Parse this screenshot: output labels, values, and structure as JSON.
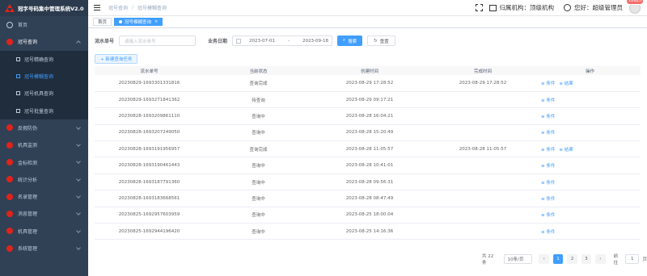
{
  "app_title": "冠字号码集中管理系统V2.0",
  "sidebar": {
    "items": [
      {
        "label": "首页",
        "icon": "home-icon"
      },
      {
        "label": "冠号查询",
        "icon": "search-icon"
      },
      {
        "label": "反假防伪",
        "icon": "shield-icon"
      },
      {
        "label": "机具监测",
        "icon": "monitor-icon"
      },
      {
        "label": "金标检测",
        "icon": "medal-icon"
      },
      {
        "label": "统计分析",
        "icon": "chart-icon"
      },
      {
        "label": "名录管理",
        "icon": "book-icon"
      },
      {
        "label": "消息管理",
        "icon": "message-icon"
      },
      {
        "label": "机具管理",
        "icon": "machine-icon"
      },
      {
        "label": "系统管理",
        "icon": "settings-icon"
      }
    ],
    "submenu": [
      {
        "label": "冠号精确查询"
      },
      {
        "label": "冠号模糊查询"
      },
      {
        "label": "冠号机具查询"
      },
      {
        "label": "冠号批量查询"
      }
    ]
  },
  "header": {
    "breadcrumb": [
      "冠号查询",
      "冠号模糊查询"
    ],
    "org_label": "归属机构：顶级机构",
    "user_label": "您好：超级管理员",
    "badge": "18925"
  },
  "tags": [
    {
      "label": "首页"
    },
    {
      "label": "冠号模糊查询"
    }
  ],
  "filter": {
    "serial_label": "流水单号",
    "serial_placeholder": "请输入流水单号",
    "date_label": "业务日期",
    "date_start": "2023-07-01",
    "date_sep": "-",
    "date_end": "2023-09-18",
    "search_btn": "搜索",
    "reset_btn": "重置"
  },
  "new_task_btn": "+ 新建查询任务",
  "table": {
    "headers": [
      "流水单号",
      "当前状态",
      "创建时间",
      "完成时间",
      "操作"
    ],
    "rows": [
      {
        "id": "20230829-1693301331816",
        "status": "查询完成",
        "created": "2023-08-29 17:28:52",
        "finished": "2023-08-29 17:28:52",
        "ops": [
          "条件",
          "结果"
        ]
      },
      {
        "id": "20230829-1693271841362",
        "status": "待查询",
        "created": "2023-08-29 09:17:21",
        "finished": "",
        "ops": [
          "条件"
        ]
      },
      {
        "id": "20230828-1693209861110",
        "status": "查询中",
        "created": "2023-08-28 16:04:21",
        "finished": "",
        "ops": [
          "条件"
        ]
      },
      {
        "id": "20230828-1693207249050",
        "status": "查询中",
        "created": "2023-08-28 15:20:49",
        "finished": "",
        "ops": [
          "条件"
        ]
      },
      {
        "id": "20230828-1693191956957",
        "status": "查询完成",
        "created": "2023-08-28 11:05:57",
        "finished": "2023-08-28 11:05:57",
        "ops": [
          "条件",
          "结果"
        ]
      },
      {
        "id": "20230828-1693190461443",
        "status": "查询中",
        "created": "2023-08-28 10:41:01",
        "finished": "",
        "ops": [
          "条件"
        ]
      },
      {
        "id": "20230828-1693187791360",
        "status": "查询中",
        "created": "2023-08-28 09:56:31",
        "finished": "",
        "ops": [
          "条件"
        ]
      },
      {
        "id": "20230828-1693183668561",
        "status": "查询中",
        "created": "2023-08-28 08:47:49",
        "finished": "",
        "ops": [
          "条件"
        ]
      },
      {
        "id": "20230825-1692957603959",
        "status": "查询中",
        "created": "2023-08-25 18:00:04",
        "finished": "",
        "ops": [
          "条件"
        ]
      },
      {
        "id": "20230825-1692944196420",
        "status": "查询中",
        "created": "2023-08-25 14:16:36",
        "finished": "",
        "ops": [
          "条件"
        ]
      }
    ]
  },
  "pager": {
    "total": "共 22 条",
    "size": "10条/页",
    "pages": [
      "1",
      "2",
      "3"
    ],
    "jump_label": "前往",
    "jump_value": "1",
    "page_suffix": "页"
  }
}
